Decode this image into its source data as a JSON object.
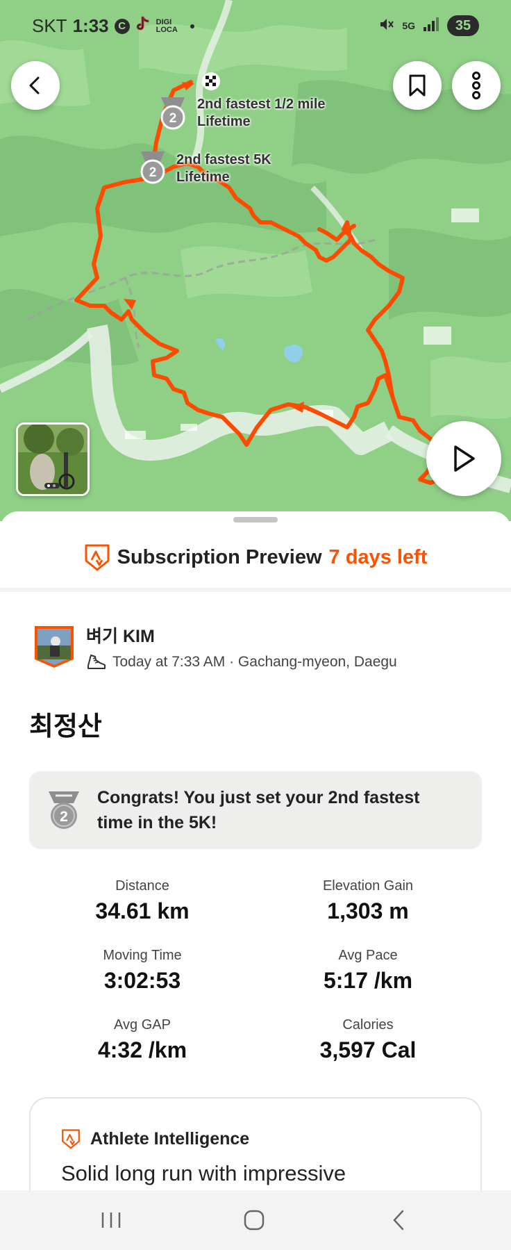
{
  "status_bar": {
    "carrier": "SKT",
    "time": "1:33",
    "badge": "C",
    "digi_line1": "DIGI",
    "digi_line2": "LOCA",
    "network": "5G",
    "battery": "35"
  },
  "map": {
    "pr_labels": [
      {
        "line1": "2nd fastest 1/2 mile",
        "line2": "Lifetime",
        "rank": "2"
      },
      {
        "line1": "2nd fastest 5K",
        "line2": "Lifetime",
        "rank": "2"
      }
    ],
    "colors": {
      "route": "#fc4c02",
      "terrain": "#8fcf86",
      "valley": "#e6efe6"
    }
  },
  "subscription": {
    "label": "Subscription Preview",
    "days_left": "7 days left"
  },
  "athlete": {
    "name": "벼기 KIM",
    "meta": "Today at 7:33 AM · Gachang-myeon, Daegu"
  },
  "activity": {
    "title": "최정산"
  },
  "achievement": {
    "rank": "2",
    "text": "Congrats! You just set your 2nd fastest time in the 5K!"
  },
  "stats": [
    {
      "label": "Distance",
      "value": "34.61 km"
    },
    {
      "label": "Elevation Gain",
      "value": "1,303 m"
    },
    {
      "label": "Moving Time",
      "value": "3:02:53"
    },
    {
      "label": "Avg Pace",
      "value": "5:17 /km"
    },
    {
      "label": "Avg GAP",
      "value": "4:32 /km"
    },
    {
      "label": "Calories",
      "value": "3,597 Cal"
    }
  ],
  "athlete_intelligence": {
    "title": "Athlete Intelligence",
    "summary": "Solid long run with impressive"
  },
  "icons": {
    "back": "back-arrow-icon",
    "bookmark": "bookmark-icon",
    "more": "more-vertical-icon",
    "play": "play-icon",
    "strava": "strava-logo-icon",
    "shoe": "running-shoe-icon",
    "medal": "silver-medal-icon"
  },
  "theme": {
    "accent": "#fc5200"
  }
}
